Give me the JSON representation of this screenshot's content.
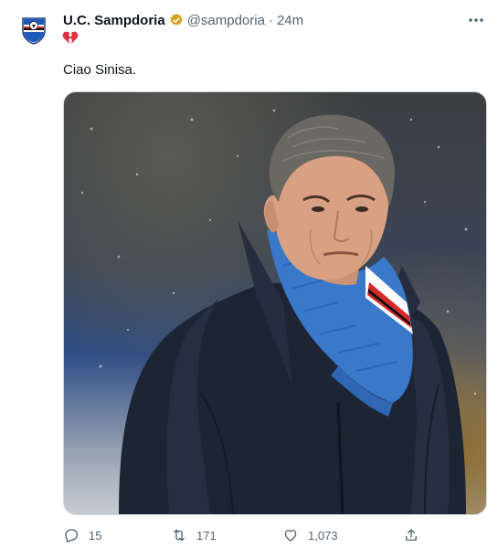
{
  "author": {
    "name": "U.C. Sampdoria",
    "handle": "@sampdoria",
    "separator": "·",
    "time": "24m",
    "verified_color": "#d1a31f"
  },
  "tweet": {
    "emoji_icon": "broken-heart-icon",
    "text": "Ciao Sinisa."
  },
  "actions": {
    "reply_count": "15",
    "retweet_count": "171",
    "like_count": "1,073"
  },
  "colors": {
    "text_primary": "#0f1419",
    "text_secondary": "#536471",
    "scarf_blue": "#3a78c9",
    "scarf_red": "#d42a2a"
  }
}
